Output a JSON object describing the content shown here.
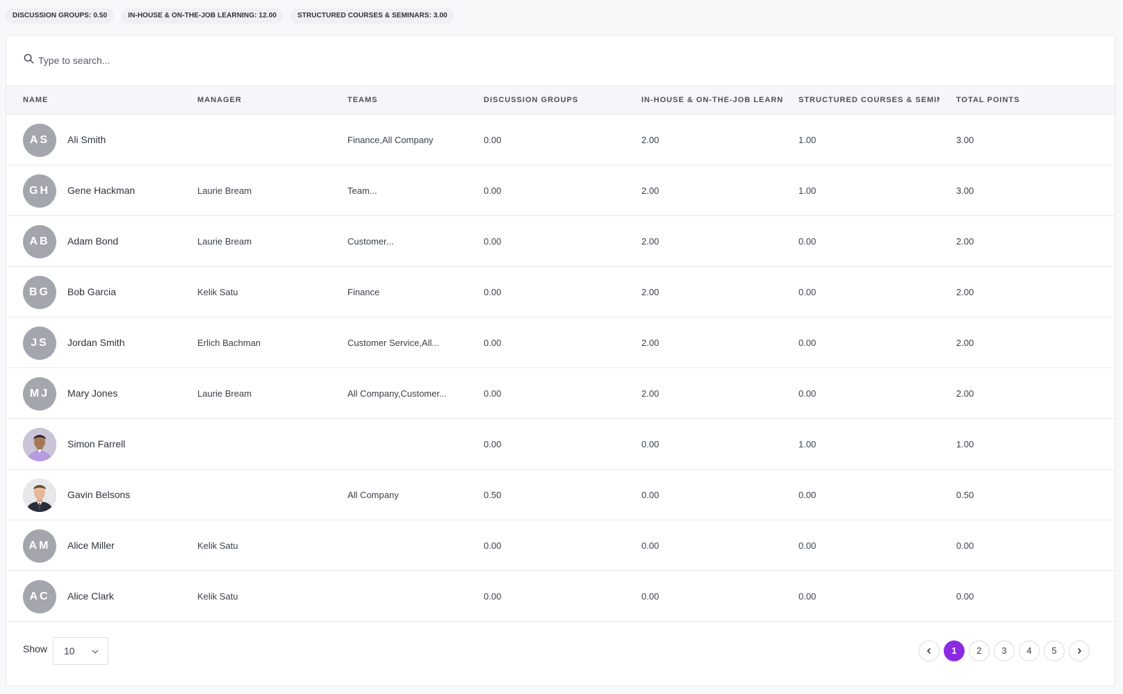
{
  "summary_chips": [
    "DISCUSSION GROUPS: 0.50",
    "IN-HOUSE & ON-THE-JOB LEARNING: 12.00",
    "STRUCTURED COURSES & SEMINARS: 3.00"
  ],
  "search": {
    "placeholder": "Type to search...",
    "icon": "search-icon"
  },
  "columns": {
    "name": "NAME",
    "manager": "MANAGER",
    "teams": "TEAMS",
    "discussion": "DISCUSSION GROUPS",
    "inhouse": "IN-HOUSE & ON-THE-JOB LEARNING",
    "structured": "STRUCTURED COURSES & SEMINARS",
    "total": "TOTAL POINTS"
  },
  "rows": [
    {
      "initials": "AS",
      "name": "Ali Smith",
      "manager": "",
      "teams": "Finance,All Company",
      "discussion": "0.00",
      "inhouse": "2.00",
      "structured": "1.00",
      "total": "3.00"
    },
    {
      "initials": "GH",
      "name": "Gene Hackman",
      "manager": "Laurie Bream",
      "teams": "Team...",
      "discussion": "0.00",
      "inhouse": "2.00",
      "structured": "1.00",
      "total": "3.00"
    },
    {
      "initials": "AB",
      "name": "Adam Bond",
      "manager": "Laurie Bream",
      "teams": "Customer...",
      "discussion": "0.00",
      "inhouse": "2.00",
      "structured": "0.00",
      "total": "2.00"
    },
    {
      "initials": "BG",
      "name": "Bob Garcia",
      "manager": "Kelik Satu",
      "teams": "Finance",
      "discussion": "0.00",
      "inhouse": "2.00",
      "structured": "0.00",
      "total": "2.00"
    },
    {
      "initials": "JS",
      "name": "Jordan Smith",
      "manager": "Erlich Bachman",
      "teams": "Customer Service,All...",
      "discussion": "0.00",
      "inhouse": "2.00",
      "structured": "0.00",
      "total": "2.00"
    },
    {
      "initials": "MJ",
      "name": "Mary Jones",
      "manager": "Laurie Bream",
      "teams": "All Company,Customer...",
      "discussion": "0.00",
      "inhouse": "2.00",
      "structured": "0.00",
      "total": "2.00"
    },
    {
      "initials": "",
      "photo": "person-photo-1",
      "name": "Simon Farrell",
      "manager": "",
      "teams": "",
      "discussion": "0.00",
      "inhouse": "0.00",
      "structured": "1.00",
      "total": "1.00"
    },
    {
      "initials": "",
      "photo": "person-photo-2",
      "name": "Gavin Belsons",
      "manager": "",
      "teams": "All Company",
      "discussion": "0.50",
      "inhouse": "0.00",
      "structured": "0.00",
      "total": "0.50"
    },
    {
      "initials": "AM",
      "name": "Alice Miller",
      "manager": "Kelik Satu",
      "teams": "",
      "discussion": "0.00",
      "inhouse": "0.00",
      "structured": "0.00",
      "total": "0.00"
    },
    {
      "initials": "AC",
      "name": "Alice Clark",
      "manager": "Kelik Satu",
      "teams": "",
      "discussion": "0.00",
      "inhouse": "0.00",
      "structured": "0.00",
      "total": "0.00"
    }
  ],
  "footer": {
    "show_label": "Show",
    "page_size": "10",
    "pages": [
      "1",
      "2",
      "3",
      "4",
      "5"
    ],
    "active_page": "1"
  },
  "colors": {
    "accent": "#8a2be2",
    "avatar_bg": "#a3a6ad",
    "header_bg": "#f4f6f9"
  }
}
